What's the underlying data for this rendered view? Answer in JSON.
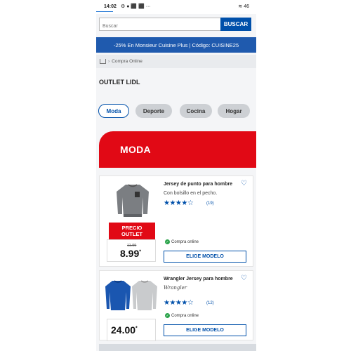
{
  "status": {
    "time": "14:02",
    "battery": "46"
  },
  "search": {
    "placeholder": "Buscar",
    "button": "BUSCAR"
  },
  "promo": {
    "text": "-25% En Monsieur Cuisine Plus | Código: CUISINE25"
  },
  "breadcrumb": {
    "label": "Compra Online"
  },
  "page": {
    "title": "OUTLET LIDL"
  },
  "categories": [
    {
      "label": "Moda",
      "active": true
    },
    {
      "label": "Deporte",
      "active": false
    },
    {
      "label": "Cocina",
      "active": false
    },
    {
      "label": "Hogar",
      "active": false
    }
  ],
  "section": {
    "title": "MODA"
  },
  "products": [
    {
      "name": "Jersey de punto para hombre",
      "description": "Con bolsillo en el pecho.",
      "rating_count": "(19)",
      "rating": 4.5,
      "outlet_label_1": "PRECIO",
      "outlet_label_2": "OUTLET",
      "old_price": "11.99",
      "price": "8.99",
      "price_mark": "*",
      "availability": "Compra online",
      "cta": "ELIGE MODELO"
    },
    {
      "name": "Wrangler Jersey para hombre",
      "brand": "Wrangler",
      "rating_count": "(12)",
      "rating": 4.5,
      "price": "24.00",
      "price_mark": "*",
      "availability": "Compra online",
      "cta": "ELIGE MODELO"
    }
  ],
  "colors": {
    "brand_blue": "#0050aa",
    "promo_blue": "#1f5aae",
    "red": "#e10915",
    "online_green": "#2aa34a"
  }
}
